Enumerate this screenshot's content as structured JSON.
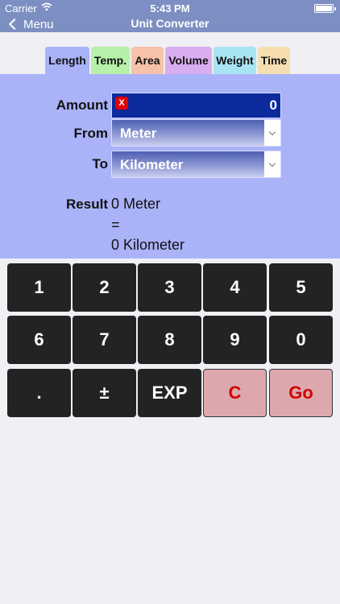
{
  "status": {
    "carrier": "Carrier",
    "time": "5:43 PM"
  },
  "nav": {
    "back_label": "Menu",
    "title": "Unit Converter"
  },
  "tabs": [
    {
      "label": "Length",
      "color": "#aab3f8"
    },
    {
      "label": "Temp.",
      "color": "#b7f0a8"
    },
    {
      "label": "Area",
      "color": "#f6c2aa"
    },
    {
      "label": "Volume",
      "color": "#d9aef0"
    },
    {
      "label": "Weight",
      "color": "#a9e4f4"
    },
    {
      "label": "Time",
      "color": "#f6deb1"
    }
  ],
  "form": {
    "amount_label": "Amount",
    "clear_label": "X",
    "amount_value": "0",
    "from_label": "From",
    "from_value": "Meter",
    "to_label": "To",
    "to_value": "Kilometer"
  },
  "result": {
    "label": "Result",
    "line1": "0 Meter",
    "line2": "=",
    "line3": "0 Kilometer"
  },
  "keypad": {
    "k1": "1",
    "k2": "2",
    "k3": "3",
    "k4": "4",
    "k5": "5",
    "k6": "6",
    "k7": "7",
    "k8": "8",
    "k9": "9",
    "k0": "0",
    "dot": ".",
    "sign": "±",
    "exp": "EXP",
    "clear": "C",
    "go": "Go"
  }
}
